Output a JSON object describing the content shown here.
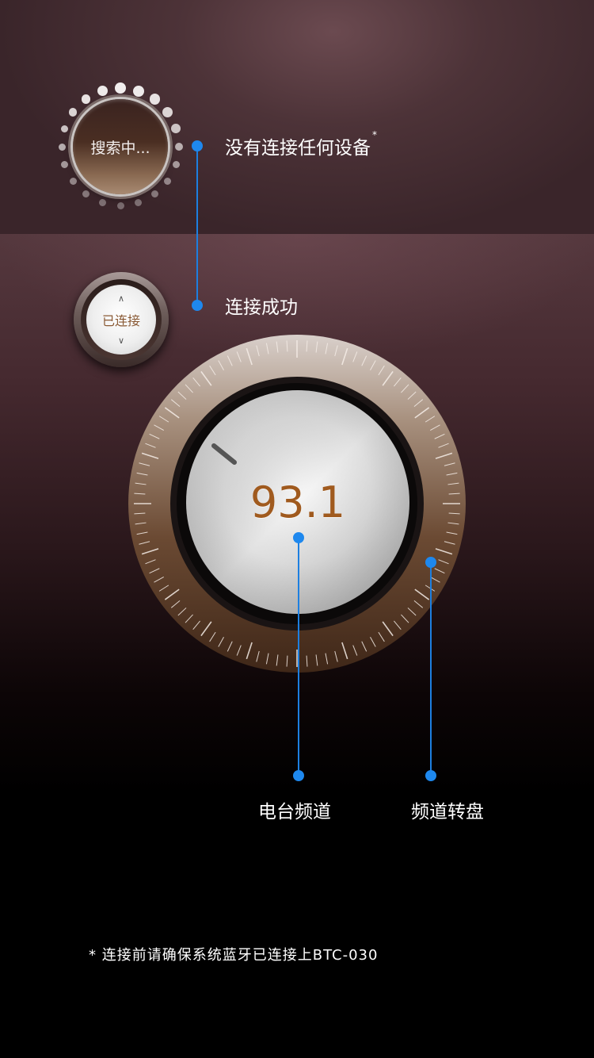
{
  "status": {
    "searching_label": "搜索中...",
    "no_device_text": "没有连接任何设备",
    "no_device_mark": "*",
    "connected_button_label": "已连接",
    "connected_text": "连接成功"
  },
  "dial": {
    "frequency": "93.1",
    "station_label": "电台频道",
    "dial_label": "频道转盘"
  },
  "footnote": {
    "mark": "*",
    "text": "连接前请确保系统蓝牙已连接上BTC-030"
  },
  "colors": {
    "accent": "#1e88ee",
    "frequency_text": "#a05a1e"
  },
  "icons": {
    "up": "chevron-up-icon",
    "down": "chevron-down-icon"
  }
}
